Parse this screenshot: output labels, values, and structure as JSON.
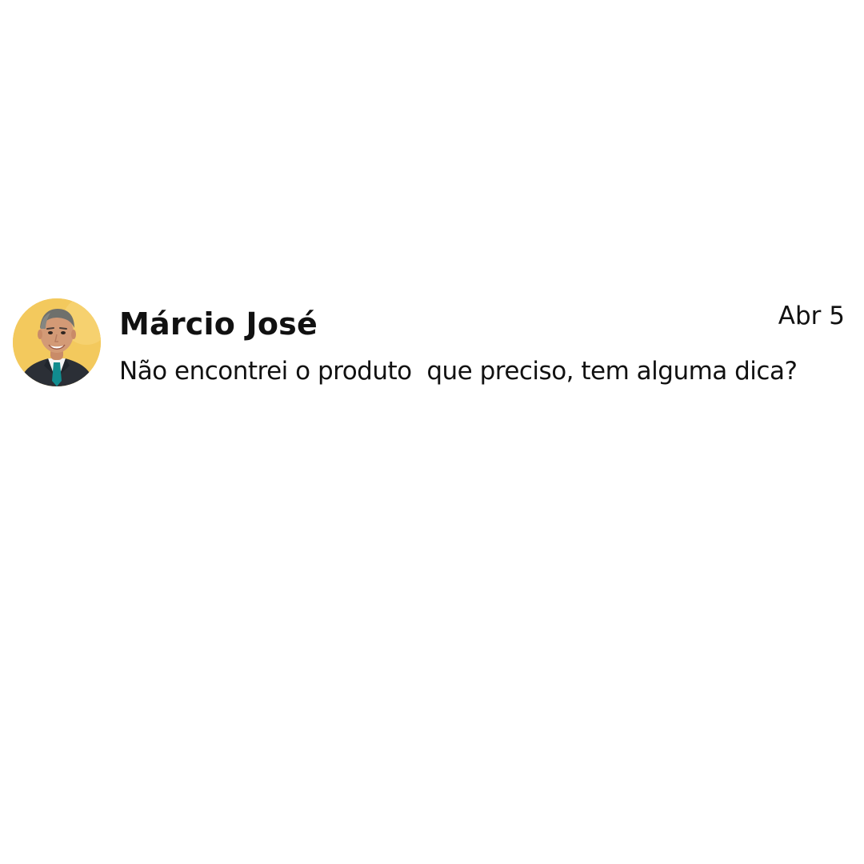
{
  "comment": {
    "author": "Márcio José",
    "date": "Abr 5",
    "message": "Não encontrei o produto  que preciso, tem alguma dica?",
    "avatar": {
      "icon": "avatar-photo",
      "background": "#f3c95d"
    }
  }
}
